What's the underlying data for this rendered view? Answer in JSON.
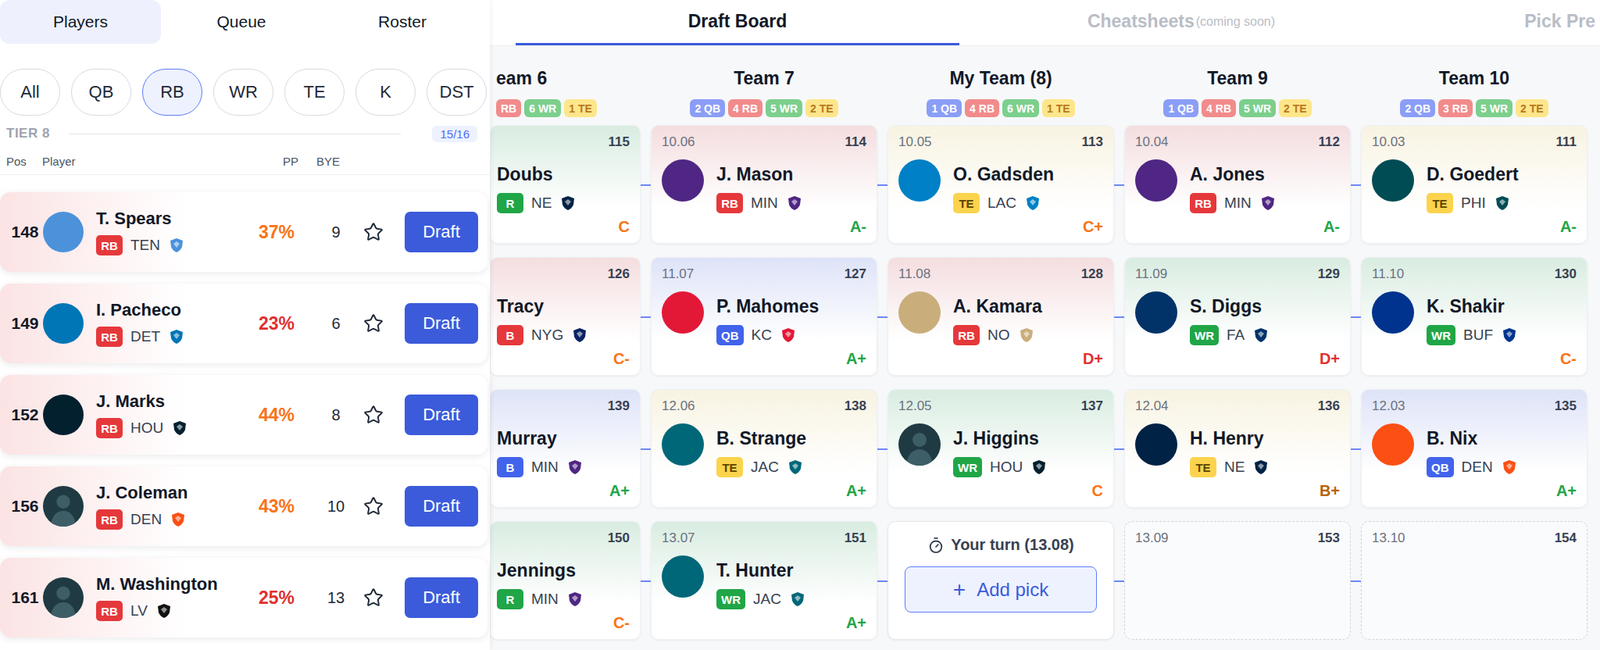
{
  "left_panel": {
    "tabs": [
      {
        "label": "Players",
        "selected": true
      },
      {
        "label": "Queue",
        "selected": false
      },
      {
        "label": "Roster",
        "selected": false
      }
    ],
    "filters": [
      {
        "label": "All",
        "selected": false
      },
      {
        "label": "QB",
        "selected": false
      },
      {
        "label": "RB",
        "selected": true
      },
      {
        "label": "WR",
        "selected": false
      },
      {
        "label": "TE",
        "selected": false
      },
      {
        "label": "K",
        "selected": false
      },
      {
        "label": "DST",
        "selected": false
      }
    ],
    "tier": {
      "title": "TIER 8",
      "count": "15/16"
    },
    "columns": [
      "Pos",
      "Player",
      "PP",
      "BYE"
    ],
    "players": [
      {
        "rank": "148",
        "name": "T. Spears",
        "pos": "RB",
        "pos_color": "#e5383b",
        "team": "TEN",
        "pp": "37%",
        "pp_color": "#f97316",
        "bye": "9",
        "starred": false,
        "avatar": "photo",
        "action": "Draft"
      },
      {
        "rank": "149",
        "name": "I. Pacheco",
        "pos": "RB",
        "pos_color": "#e5383b",
        "team": "DET",
        "pp": "23%",
        "pp_color": "#e03131",
        "bye": "6",
        "starred": false,
        "avatar": "photo",
        "action": "Draft"
      },
      {
        "rank": "152",
        "name": "J. Marks",
        "pos": "RB",
        "pos_color": "#e5383b",
        "team": "HOU",
        "pp": "44%",
        "pp_color": "#f97316",
        "bye": "8",
        "starred": false,
        "avatar": "photo",
        "action": "Draft"
      },
      {
        "rank": "156",
        "name": "J. Coleman",
        "pos": "RB",
        "pos_color": "#e5383b",
        "team": "DEN",
        "pp": "43%",
        "pp_color": "#f97316",
        "bye": "10",
        "starred": false,
        "avatar": "placeholder",
        "action": "Draft"
      },
      {
        "rank": "161",
        "name": "M. Washington",
        "pos": "RB",
        "pos_color": "#e5383b",
        "team": "LV",
        "pp": "25%",
        "pp_color": "#e03131",
        "bye": "13",
        "starred": false,
        "avatar": "placeholder",
        "action": "Draft"
      }
    ]
  },
  "board": {
    "tabs": [
      {
        "label": "Draft Board",
        "note": "",
        "selected": true
      },
      {
        "label": "Cheatsheets",
        "note": "(coming soon)",
        "selected": false
      },
      {
        "label": "Pick Pre",
        "note": "",
        "selected": false
      }
    ],
    "teams": [
      {
        "name": "eam 6",
        "partial": true,
        "tags": [
          {
            "label": "RB",
            "color": "#f28b8b"
          },
          {
            "label": "6 WR",
            "color": "#7ccf8c"
          },
          {
            "label": "1 TE",
            "color": "#fde68a"
          }
        ],
        "cells": [
          {
            "kind": "pick",
            "number": "115",
            "name": "Doubs",
            "pos": "R",
            "pos_color": "#20a647",
            "team": "NE",
            "grade": "C",
            "grade_color": "#f97316",
            "avatar": "none"
          },
          {
            "kind": "pick",
            "number": "126",
            "name": "Tracy",
            "pos": "B",
            "pos_color": "#e5383b",
            "team": "NYG",
            "grade": "C-",
            "grade_color": "#f97316",
            "avatar": "none"
          },
          {
            "kind": "pick",
            "number": "139",
            "name": "Murray",
            "pos": "B",
            "pos_color": "#4263eb",
            "team": "MIN",
            "grade": "A+",
            "grade_color": "#22a447",
            "avatar": "none"
          },
          {
            "kind": "pick",
            "number": "150",
            "name": "Jennings",
            "pos": "R",
            "pos_color": "#20a647",
            "team": "MIN",
            "grade": "C-",
            "grade_color": "#f97316",
            "avatar": "none"
          }
        ]
      },
      {
        "name": "Team 7",
        "partial": false,
        "tags": [
          {
            "label": "2 QB",
            "color": "#8b9ef6"
          },
          {
            "label": "4 RB",
            "color": "#f28b8b"
          },
          {
            "label": "5 WR",
            "color": "#7ccf8c"
          },
          {
            "label": "2 TE",
            "color": "#fde68a"
          }
        ],
        "cells": [
          {
            "kind": "pick",
            "label": "10.06",
            "number": "114",
            "name": "J. Mason",
            "pos": "RB",
            "pos_color": "#e5383b",
            "team": "MIN",
            "grade": "A-",
            "grade_color": "#22a447",
            "avatar": "photo"
          },
          {
            "kind": "pick",
            "label": "11.07",
            "number": "127",
            "name": "P. Mahomes",
            "pos": "QB",
            "pos_color": "#4263eb",
            "team": "KC",
            "grade": "A+",
            "grade_color": "#22a447",
            "avatar": "photo"
          },
          {
            "kind": "pick",
            "label": "12.06",
            "number": "138",
            "name": "B. Strange",
            "pos": "TE",
            "pos_color": "#fcd34d",
            "team": "JAC",
            "grade": "A+",
            "grade_color": "#22a447",
            "avatar": "photo"
          },
          {
            "kind": "pick",
            "label": "13.07",
            "number": "151",
            "name": "T. Hunter",
            "pos": "WR",
            "pos_color": "#20a647",
            "team": "JAC",
            "grade": "A+",
            "grade_color": "#22a447",
            "avatar": "photo"
          }
        ]
      },
      {
        "name": "My Team (8)",
        "partial": false,
        "tags": [
          {
            "label": "1 QB",
            "color": "#8b9ef6"
          },
          {
            "label": "4 RB",
            "color": "#f28b8b"
          },
          {
            "label": "6 WR",
            "color": "#7ccf8c"
          },
          {
            "label": "1 TE",
            "color": "#fde68a"
          }
        ],
        "cells": [
          {
            "kind": "pick",
            "label": "10.05",
            "number": "113",
            "name": "O. Gadsden",
            "pos": "TE",
            "pos_color": "#fcd34d",
            "team": "LAC",
            "grade": "C+",
            "grade_color": "#f97316",
            "avatar": "photo"
          },
          {
            "kind": "pick",
            "label": "11.08",
            "number": "128",
            "name": "A. Kamara",
            "pos": "RB",
            "pos_color": "#e5383b",
            "team": "NO",
            "grade": "D+",
            "grade_color": "#e03131",
            "avatar": "photo"
          },
          {
            "kind": "pick",
            "label": "12.05",
            "number": "137",
            "name": "J. Higgins",
            "pos": "WR",
            "pos_color": "#20a647",
            "team": "HOU",
            "grade": "C",
            "grade_color": "#f97316",
            "avatar": "placeholder"
          },
          {
            "kind": "current",
            "label": "Your turn (13.08)",
            "action": "Add pick",
            "action_icon": "+"
          }
        ]
      },
      {
        "name": "Team 9",
        "partial": false,
        "tags": [
          {
            "label": "1 QB",
            "color": "#8b9ef6"
          },
          {
            "label": "4 RB",
            "color": "#f28b8b"
          },
          {
            "label": "5 WR",
            "color": "#7ccf8c"
          },
          {
            "label": "2 TE",
            "color": "#fde68a"
          }
        ],
        "cells": [
          {
            "kind": "pick",
            "label": "10.04",
            "number": "112",
            "name": "A. Jones",
            "pos": "RB",
            "pos_color": "#e5383b",
            "team": "MIN",
            "grade": "A-",
            "grade_color": "#22a447",
            "avatar": "photo"
          },
          {
            "kind": "pick",
            "label": "11.09",
            "number": "129",
            "name": "S. Diggs",
            "pos": "WR",
            "pos_color": "#20a647",
            "team": "FA",
            "grade": "D+",
            "grade_color": "#e03131",
            "avatar": "photo"
          },
          {
            "kind": "pick",
            "label": "12.04",
            "number": "136",
            "name": "H. Henry",
            "pos": "TE",
            "pos_color": "#fcd34d",
            "team": "NE",
            "grade": "B+",
            "grade_color": "#b7630b",
            "avatar": "photo"
          },
          {
            "kind": "empty",
            "label": "13.09",
            "number": "153"
          }
        ]
      },
      {
        "name": "Team 10",
        "partial": false,
        "tags": [
          {
            "label": "2 QB",
            "color": "#8b9ef6"
          },
          {
            "label": "3 RB",
            "color": "#f28b8b"
          },
          {
            "label": "5 WR",
            "color": "#7ccf8c"
          },
          {
            "label": "2 TE",
            "color": "#fde68a"
          }
        ],
        "cells": [
          {
            "kind": "pick",
            "label": "10.03",
            "number": "111",
            "name": "D. Goedert",
            "pos": "TE",
            "pos_color": "#fcd34d",
            "team": "PHI",
            "grade": "A-",
            "grade_color": "#22a447",
            "avatar": "photo"
          },
          {
            "kind": "pick",
            "label": "11.10",
            "number": "130",
            "name": "K. Shakir",
            "pos": "WR",
            "pos_color": "#20a647",
            "team": "BUF",
            "grade": "C-",
            "grade_color": "#f97316",
            "avatar": "photo"
          },
          {
            "kind": "pick",
            "label": "12.03",
            "number": "135",
            "name": "B. Nix",
            "pos": "QB",
            "pos_color": "#4263eb",
            "team": "DEN",
            "grade": "A+",
            "grade_color": "#22a447",
            "avatar": "photo"
          },
          {
            "kind": "empty",
            "label": "13.10",
            "number": "154"
          }
        ]
      }
    ]
  }
}
